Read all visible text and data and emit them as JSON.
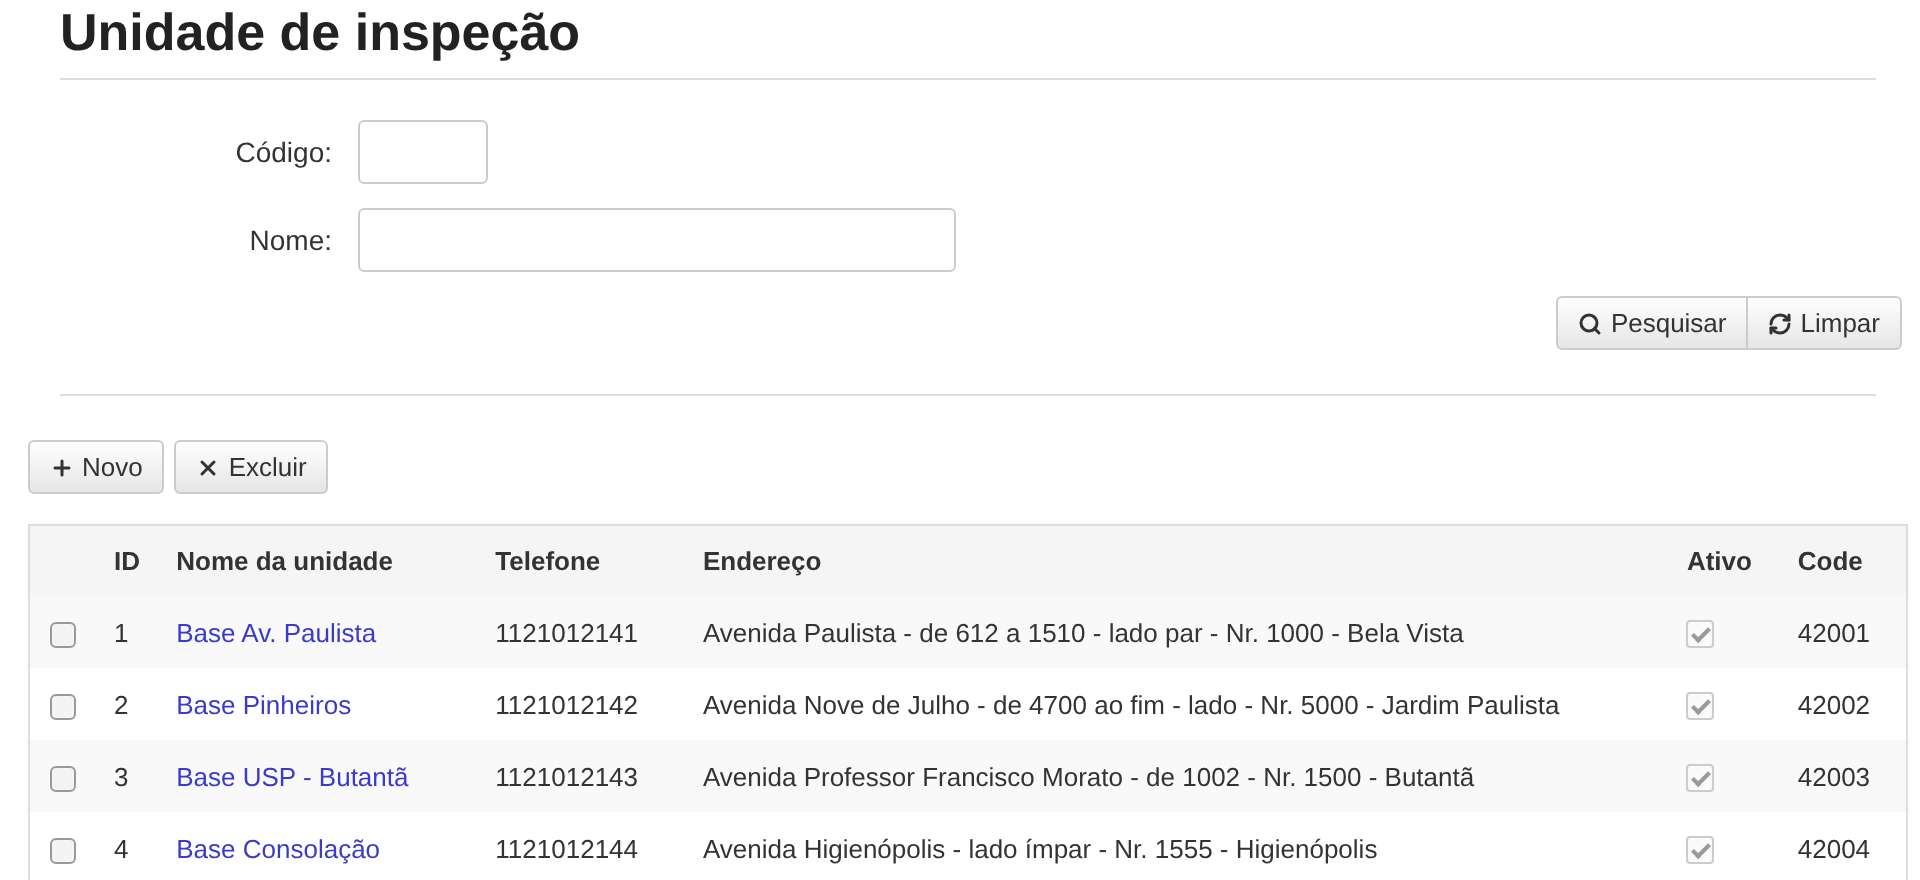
{
  "title": "Unidade de inspeção",
  "filters": [
    {
      "label": "Código:"
    },
    {
      "label": "Nome:"
    }
  ],
  "search_actions": [
    {
      "kind": "search",
      "label": "Pesquisar"
    },
    {
      "kind": "clear",
      "label": "Limpar"
    }
  ],
  "toolbar": [
    {
      "kind": "add",
      "label": "Novo"
    },
    {
      "kind": "delete",
      "label": "Excluir"
    }
  ],
  "table": {
    "columns": [
      "ID",
      "Nome da unidade",
      "Telefone",
      "Endereço",
      "Ativo",
      "Code"
    ],
    "rows": [
      {
        "selected": false,
        "id": "1",
        "name": "Base Av. Paulista",
        "phone": "1121012141",
        "address": "Avenida Paulista - de 612 a 1510 - lado par - Nr. 1000 - Bela Vista",
        "active": true,
        "code": "42001"
      },
      {
        "selected": false,
        "id": "2",
        "name": "Base Pinheiros",
        "phone": "1121012142",
        "address": "Avenida Nove de Julho - de 4700 ao fim - lado - Nr. 5000 - Jardim Paulista",
        "active": true,
        "code": "42002"
      },
      {
        "selected": false,
        "id": "3",
        "name": "Base USP - Butantã",
        "phone": "1121012143",
        "address": "Avenida Professor Francisco Morato - de 1002 - Nr. 1500 - Butantã",
        "active": true,
        "code": "42003"
      },
      {
        "selected": false,
        "id": "4",
        "name": "Base Consolação",
        "phone": "1121012144",
        "address": "Avenida Higienópolis - lado ímpar - Nr. 1555 - Higienópolis",
        "active": true,
        "code": "42004"
      }
    ]
  }
}
